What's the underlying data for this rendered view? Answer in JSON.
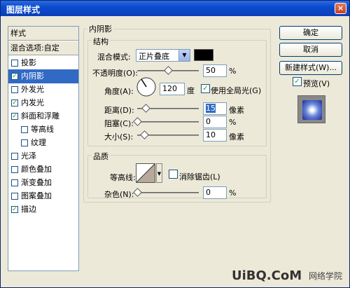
{
  "title": "图层样式",
  "close_glyph": "×",
  "sidebar": {
    "header": "样式",
    "blend": "混合选项:自定",
    "items": [
      {
        "label": "投影",
        "checked": false,
        "sub": false
      },
      {
        "label": "内阴影",
        "checked": true,
        "sub": false,
        "selected": true
      },
      {
        "label": "外发光",
        "checked": false,
        "sub": false
      },
      {
        "label": "内发光",
        "checked": true,
        "sub": false
      },
      {
        "label": "斜面和浮雕",
        "checked": true,
        "sub": false
      },
      {
        "label": "等高线",
        "checked": false,
        "sub": true
      },
      {
        "label": "纹理",
        "checked": false,
        "sub": true
      },
      {
        "label": "光泽",
        "checked": false,
        "sub": false
      },
      {
        "label": "颜色叠加",
        "checked": false,
        "sub": false
      },
      {
        "label": "渐变叠加",
        "checked": false,
        "sub": false
      },
      {
        "label": "图案叠加",
        "checked": false,
        "sub": false
      },
      {
        "label": "描边",
        "checked": true,
        "sub": false
      }
    ],
    "check_glyph": "✓"
  },
  "panel": {
    "title": "内阴影",
    "structure": {
      "legend": "结构",
      "blend_mode_label": "混合模式:",
      "blend_mode_value": "正片叠底",
      "blend_color": "#000000",
      "opacity_label": "不透明度(O):",
      "opacity_value": "50",
      "opacity_unit": "%",
      "opacity_level": 0.5,
      "angle_label": "角度(A):",
      "angle_value": "120",
      "angle_unit": "度",
      "global_light_label": "使用全局光(G)",
      "global_light_checked": true,
      "distance_label": "距离(D):",
      "distance_value": "15",
      "distance_unit": "像素",
      "choke_label": "阻塞(C):",
      "choke_value": "0",
      "choke_unit": "%",
      "size_label": "大小(S):",
      "size_value": "10",
      "size_unit": "像素"
    },
    "quality": {
      "legend": "品质",
      "contour_label": "等高线:",
      "antialias_label": "消除锯齿(L)",
      "antialias_checked": false,
      "noise_label": "杂色(N):",
      "noise_value": "0",
      "noise_unit": "%"
    }
  },
  "buttons": {
    "ok": "确定",
    "cancel": "取消",
    "new_style": "新建样式(W)...",
    "preview_label": "预览(V)",
    "preview_checked": true
  },
  "watermark": {
    "brand": "UiBQ.CoM",
    "site": "网络学院"
  },
  "colors": {
    "accent": "#316ac5",
    "titlebar": "#0b4bd0"
  }
}
